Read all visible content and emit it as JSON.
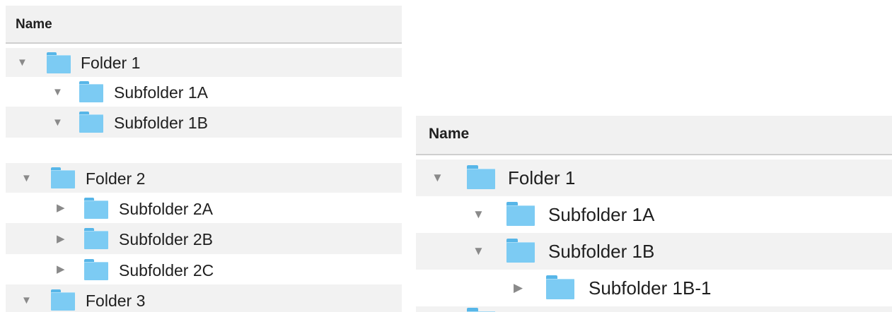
{
  "left_panel": {
    "column_header": "Name",
    "rows": [
      {
        "label": "Folder 1",
        "expanded": true,
        "icon": "folder-icon"
      },
      {
        "label": "Subfolder 1A",
        "expanded": true,
        "icon": "folder-icon"
      },
      {
        "label": "Subfolder 1B",
        "expanded": true,
        "icon": "folder-icon"
      },
      {
        "label": "Folder 2",
        "expanded": true,
        "icon": "folder-icon"
      },
      {
        "label": "Subfolder 2A",
        "expanded": false,
        "icon": "folder-icon"
      },
      {
        "label": "Subfolder 2B",
        "expanded": false,
        "icon": "folder-icon"
      },
      {
        "label": "Subfolder 2C",
        "expanded": false,
        "icon": "folder-icon"
      },
      {
        "label": "Folder 3",
        "expanded": true,
        "icon": "folder-icon"
      }
    ]
  },
  "right_panel": {
    "column_header": "Name",
    "rows": [
      {
        "label": "Folder 1",
        "expanded": true,
        "icon": "folder-icon"
      },
      {
        "label": "Subfolder 1A",
        "expanded": true,
        "icon": "folder-icon"
      },
      {
        "label": "Subfolder 1B",
        "expanded": true,
        "icon": "folder-icon"
      },
      {
        "label": "Subfolder 1B-1",
        "expanded": false,
        "icon": "folder-icon"
      }
    ]
  },
  "glyphs": {
    "expanded": "▼",
    "collapsed": "▶"
  },
  "colors": {
    "folder": "#7ccbf3",
    "folder_tab": "#57b6e8",
    "row_stripe": "#f2f2f2",
    "disclosure": "#8a8a8a"
  }
}
